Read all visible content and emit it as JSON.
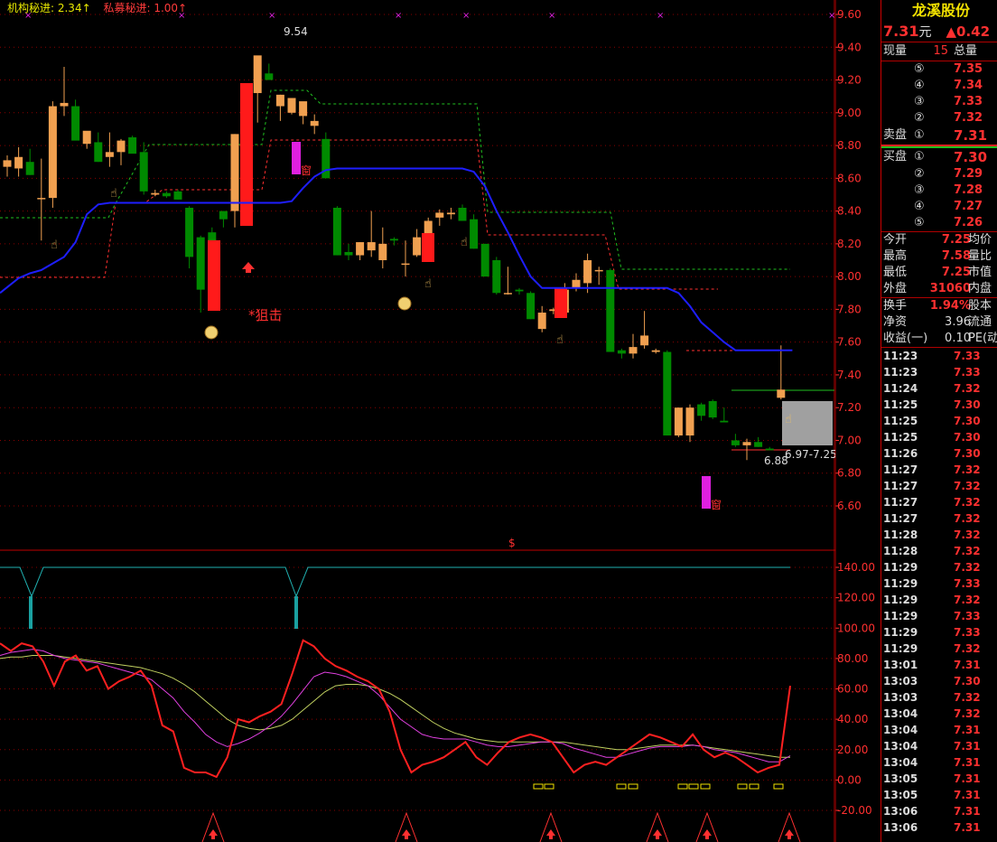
{
  "legend": {
    "inst": "机构秘进: 2.34↑",
    "pe": "私募秘进: 1.00↑"
  },
  "annotations": {
    "high": "9.54",
    "low": "6.88",
    "range": "6.97-7.25",
    "sniper": "*狙击",
    "window1": "窗",
    "window2": "窗",
    "dollar": "$"
  },
  "colors": {
    "up": "#ff3030",
    "down": "#008a00",
    "ma": "#1e1eff",
    "bull_body": "#f0a050",
    "mauve": "#e020e0",
    "cyan": "#20e0e0"
  },
  "price_axis": {
    "labels": [
      "9.60",
      "9.40",
      "9.20",
      "9.00",
      "8.80",
      "8.60",
      "8.40",
      "8.20",
      "8.00",
      "7.80",
      "7.60",
      "7.40",
      "7.20",
      "7.00",
      "6.80",
      "6.60"
    ]
  },
  "osc_axis": {
    "labels": [
      "140.00",
      "120.00",
      "100.00",
      "80.00",
      "60.00",
      "40.00",
      "20.00",
      "0.00",
      "-20.00"
    ]
  },
  "chart_data": {
    "type": "candlestick",
    "title": "",
    "candles_ohlc": [
      [
        8.67,
        8.74,
        8.61,
        8.71
      ],
      [
        8.66,
        8.79,
        8.61,
        8.73
      ],
      [
        8.7,
        8.78,
        8.62,
        8.62
      ],
      [
        8.48,
        8.72,
        8.22,
        8.48
      ],
      [
        8.48,
        9.07,
        8.42,
        9.04
      ],
      [
        9.04,
        9.28,
        8.98,
        9.06
      ],
      [
        9.04,
        9.08,
        8.86,
        8.83
      ],
      [
        8.81,
        8.87,
        8.78,
        8.89
      ],
      [
        8.82,
        8.88,
        8.7,
        8.7
      ],
      [
        8.73,
        8.88,
        8.67,
        8.76
      ],
      [
        8.76,
        8.84,
        8.68,
        8.83
      ],
      [
        8.85,
        8.86,
        8.8,
        8.75
      ],
      [
        8.76,
        8.82,
        8.5,
        8.52
      ],
      [
        8.5,
        8.53,
        8.49,
        8.51
      ],
      [
        8.51,
        8.52,
        8.48,
        8.49
      ],
      [
        8.52,
        8.53,
        8.47,
        8.47
      ],
      [
        8.42,
        8.43,
        8.05,
        8.12
      ],
      [
        8.24,
        8.25,
        7.78,
        7.92
      ],
      [
        8.27,
        8.3,
        8.13,
        8.13
      ],
      [
        8.4,
        8.4,
        8.3,
        8.35
      ],
      [
        8.4,
        8.87,
        8.3,
        8.87
      ],
      [
        9.0,
        9.08,
        8.98,
        9.0
      ],
      [
        9.12,
        9.33,
        8.94,
        9.35
      ],
      [
        9.24,
        9.3,
        9.2,
        9.2
      ],
      [
        9.04,
        9.11,
        8.95,
        9.11
      ],
      [
        9.0,
        9.06,
        8.99,
        9.09
      ],
      [
        8.98,
        8.99,
        8.93,
        9.07
      ],
      [
        8.92,
        8.99,
        8.87,
        8.95
      ],
      [
        8.84,
        8.88,
        8.6,
        8.6
      ],
      [
        8.42,
        8.43,
        8.13,
        8.13
      ],
      [
        8.15,
        8.2,
        8.1,
        8.13
      ],
      [
        8.13,
        8.21,
        8.1,
        8.21
      ],
      [
        8.16,
        8.4,
        8.12,
        8.21
      ],
      [
        8.1,
        8.3,
        8.05,
        8.2
      ],
      [
        8.23,
        8.24,
        8.19,
        8.22
      ],
      [
        8.08,
        8.22,
        8.0,
        8.08
      ],
      [
        8.13,
        8.29,
        8.12,
        8.24
      ],
      [
        8.24,
        8.36,
        8.16,
        8.34
      ],
      [
        8.36,
        8.41,
        8.31,
        8.39
      ],
      [
        8.38,
        8.42,
        8.35,
        8.39
      ],
      [
        8.42,
        8.44,
        8.34,
        8.34
      ],
      [
        8.35,
        8.38,
        8.17,
        8.17
      ],
      [
        8.2,
        8.2,
        8.06,
        8.0
      ],
      [
        8.1,
        8.12,
        7.89,
        7.9
      ],
      [
        7.9,
        8.06,
        7.89,
        7.9
      ],
      [
        7.92,
        7.93,
        7.89,
        7.91
      ],
      [
        7.9,
        7.91,
        7.74,
        7.74
      ],
      [
        7.68,
        7.82,
        7.66,
        7.78
      ],
      [
        7.79,
        7.81,
        7.77,
        7.8
      ],
      [
        7.78,
        7.96,
        7.77,
        7.92
      ],
      [
        7.93,
        8.02,
        7.91,
        7.98
      ],
      [
        7.96,
        8.14,
        7.9,
        8.1
      ],
      [
        8.04,
        8.06,
        7.95,
        8.04
      ],
      [
        8.04,
        8.05,
        7.55,
        7.54
      ],
      [
        7.55,
        7.56,
        7.5,
        7.53
      ],
      [
        7.53,
        7.65,
        7.5,
        7.57
      ],
      [
        7.58,
        7.79,
        7.56,
        7.64
      ],
      [
        7.54,
        7.56,
        7.53,
        7.55
      ],
      [
        7.54,
        7.55,
        7.03,
        7.03
      ],
      [
        7.03,
        7.2,
        7.02,
        7.2
      ],
      [
        7.03,
        7.22,
        6.99,
        7.2
      ],
      [
        7.22,
        7.23,
        7.12,
        7.15
      ],
      [
        7.24,
        7.25,
        7.13,
        7.14
      ],
      [
        7.12,
        7.2,
        7.11,
        7.11
      ],
      [
        7.0,
        7.04,
        6.96,
        6.97
      ],
      [
        6.97,
        7.01,
        6.88,
        6.99
      ],
      [
        6.99,
        7.02,
        6.96,
        6.96
      ],
      [
        6.95,
        6.96,
        6.94,
        6.94
      ],
      [
        7.26,
        7.58,
        7.25,
        7.31
      ]
    ],
    "ma_line": [
      7.9,
      7.99,
      8.02,
      8.04,
      8.08,
      8.12,
      8.21,
      8.38,
      8.44,
      8.45,
      8.45,
      8.45,
      8.45,
      8.45,
      8.45,
      8.45,
      8.45,
      8.45,
      8.45,
      8.45,
      8.45,
      8.45,
      8.45,
      8.45,
      8.45,
      8.46,
      8.54,
      8.61,
      8.65,
      8.66,
      8.66,
      8.66,
      8.66,
      8.66,
      8.66,
      8.66,
      8.66,
      8.66,
      8.66,
      8.66,
      8.66,
      8.64,
      8.55,
      8.4,
      8.27,
      8.13,
      8.0,
      7.93,
      7.93,
      7.93,
      7.93,
      7.93,
      7.93,
      7.93,
      7.93,
      7.93,
      7.93,
      7.93,
      7.93,
      7.9,
      7.82,
      7.72,
      7.66,
      7.6,
      7.55,
      7.55,
      7.55,
      7.55,
      7.55,
      7.55
    ],
    "k_line": [
      90,
      85,
      90,
      88,
      78,
      62,
      78,
      82,
      72,
      75,
      60,
      65,
      68,
      72,
      62,
      36,
      32,
      8,
      5,
      5,
      2,
      15,
      40,
      38,
      42,
      45,
      50,
      70,
      92,
      88,
      80,
      75,
      72,
      68,
      65,
      60,
      45,
      20,
      5,
      10,
      12,
      15,
      20,
      25,
      15,
      10,
      18,
      25,
      28,
      30,
      28,
      25,
      15,
      5,
      10,
      12,
      10,
      15,
      20,
      25,
      30,
      28,
      25,
      22,
      30,
      20,
      15,
      18,
      15,
      10,
      5,
      8,
      10,
      62
    ],
    "d_line": [
      82,
      84,
      85,
      86,
      85,
      82,
      80,
      79,
      78,
      77,
      75,
      73,
      71,
      69,
      66,
      60,
      54,
      45,
      38,
      30,
      25,
      22,
      24,
      27,
      31,
      36,
      42,
      50,
      59,
      68,
      71,
      70,
      68,
      65,
      62,
      56,
      48,
      40,
      35,
      30,
      28,
      27,
      27,
      27,
      25,
      23,
      22,
      22,
      23,
      24,
      25,
      25,
      24,
      21,
      19,
      17,
      15,
      15,
      17,
      19,
      21,
      22,
      22,
      22,
      23,
      22,
      20,
      19,
      18,
      16,
      14,
      12,
      12,
      16
    ],
    "j_line": [
      80,
      81,
      81,
      82,
      82,
      82,
      81,
      80,
      79,
      78,
      77,
      76,
      75,
      74,
      72,
      70,
      67,
      63,
      58,
      52,
      46,
      40,
      36,
      34,
      33,
      34,
      36,
      40,
      46,
      52,
      58,
      62,
      63,
      63,
      62,
      60,
      57,
      53,
      48,
      43,
      38,
      34,
      31,
      29,
      27,
      26,
      25,
      25,
      25,
      25,
      25,
      25,
      25,
      24,
      23,
      22,
      21,
      20,
      20,
      21,
      22,
      23,
      23,
      23,
      23,
      22,
      21,
      20,
      19,
      18,
      17,
      16,
      15,
      15
    ]
  },
  "panel": {
    "name": "龙溪股份",
    "price": "7.31",
    "unit": "元",
    "change": "▲0.42",
    "cur_vol_label": "现量",
    "cur_vol": "15",
    "total_label": "总量",
    "asks": [
      {
        "label": "",
        "num": "⑤",
        "price": "7.35"
      },
      {
        "label": "",
        "num": "④",
        "price": "7.34"
      },
      {
        "label": "",
        "num": "③",
        "price": "7.33"
      },
      {
        "label": "",
        "num": "②",
        "price": "7.32"
      },
      {
        "label": "卖盘",
        "num": "①",
        "price": "7.31"
      }
    ],
    "bids": [
      {
        "label": "买盘",
        "num": "①",
        "price": "7.30"
      },
      {
        "label": "",
        "num": "②",
        "price": "7.29"
      },
      {
        "label": "",
        "num": "③",
        "price": "7.28"
      },
      {
        "label": "",
        "num": "④",
        "price": "7.27"
      },
      {
        "label": "",
        "num": "⑤",
        "price": "7.26"
      }
    ],
    "stats1": [
      {
        "k": "今开",
        "v": "7.25",
        "k2": "均价"
      },
      {
        "k": "最高",
        "v": "7.58",
        "k2": "量比"
      },
      {
        "k": "最低",
        "v": "7.25",
        "k2": "市值"
      },
      {
        "k": "外盘",
        "v": "31060",
        "k2": "内盘"
      }
    ],
    "stats2": [
      {
        "k": "换手",
        "v": "1.94%",
        "k2": "股本"
      },
      {
        "k": "净资",
        "v": "3.96",
        "k2": "流通"
      },
      {
        "k": "收益(一)",
        "v": "0.10",
        "k2": "PE(动"
      }
    ],
    "ticks": [
      [
        "11:23",
        "7.33"
      ],
      [
        "11:23",
        "7.33"
      ],
      [
        "11:24",
        "7.32"
      ],
      [
        "11:25",
        "7.30"
      ],
      [
        "11:25",
        "7.30"
      ],
      [
        "11:25",
        "7.30"
      ],
      [
        "11:26",
        "7.30"
      ],
      [
        "11:27",
        "7.32"
      ],
      [
        "11:27",
        "7.32"
      ],
      [
        "11:27",
        "7.32"
      ],
      [
        "11:27",
        "7.32"
      ],
      [
        "11:28",
        "7.32"
      ],
      [
        "11:28",
        "7.32"
      ],
      [
        "11:29",
        "7.32"
      ],
      [
        "11:29",
        "7.33"
      ],
      [
        "11:29",
        "7.32"
      ],
      [
        "11:29",
        "7.33"
      ],
      [
        "11:29",
        "7.33"
      ],
      [
        "11:29",
        "7.32"
      ],
      [
        "13:01",
        "7.31"
      ],
      [
        "13:03",
        "7.30"
      ],
      [
        "13:03",
        "7.32"
      ],
      [
        "13:04",
        "7.32"
      ],
      [
        "13:04",
        "7.31"
      ],
      [
        "13:04",
        "7.31"
      ],
      [
        "13:04",
        "7.31"
      ],
      [
        "13:05",
        "7.31"
      ],
      [
        "13:05",
        "7.31"
      ],
      [
        "13:06",
        "7.31"
      ],
      [
        "13:06",
        "7.31"
      ]
    ]
  }
}
